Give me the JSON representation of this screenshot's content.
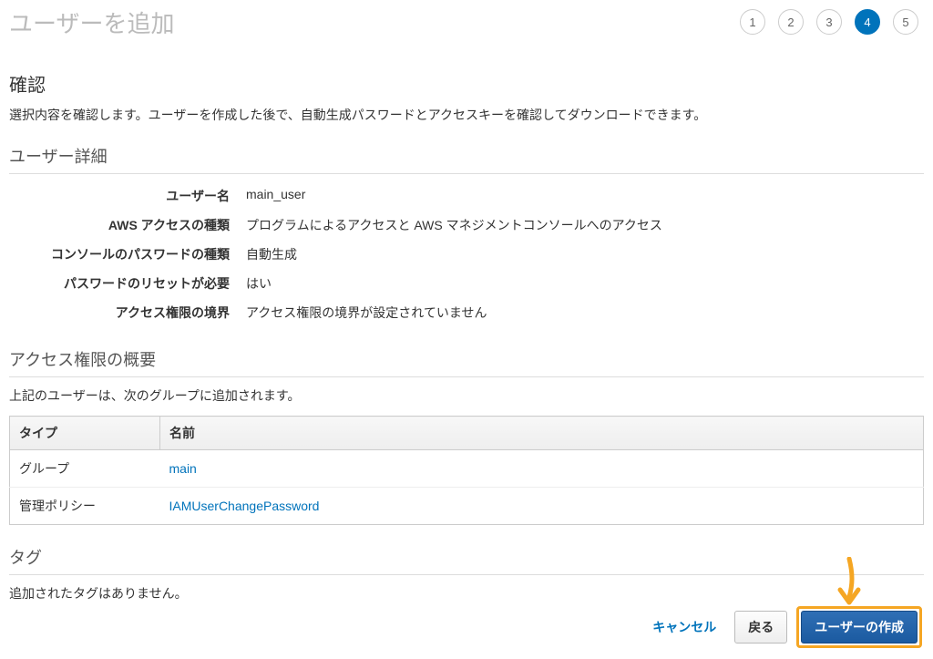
{
  "header": {
    "title": "ユーザーを追加",
    "steps": [
      "1",
      "2",
      "3",
      "4",
      "5"
    ],
    "active_step_index": 3
  },
  "confirm": {
    "heading": "確認",
    "description": "選択内容を確認します。ユーザーを作成した後で、自動生成パスワードとアクセスキーを確認してダウンロードできます。"
  },
  "user_details": {
    "heading": "ユーザー詳細",
    "rows": [
      {
        "label": "ユーザー名",
        "value": "main_user"
      },
      {
        "label": "AWS アクセスの種類",
        "value": "プログラムによるアクセスと AWS マネジメントコンソールへのアクセス"
      },
      {
        "label": "コンソールのパスワードの種類",
        "value": "自動生成"
      },
      {
        "label": "パスワードのリセットが必要",
        "value": "はい"
      },
      {
        "label": "アクセス権限の境界",
        "value": "アクセス権限の境界が設定されていません"
      }
    ]
  },
  "permissions": {
    "heading": "アクセス権限の概要",
    "description": "上記のユーザーは、次のグループに追加されます。",
    "columns": {
      "type": "タイプ",
      "name": "名前"
    },
    "rows": [
      {
        "type": "グループ",
        "name": "main"
      },
      {
        "type": "管理ポリシー",
        "name": "IAMUserChangePassword"
      }
    ]
  },
  "tags": {
    "heading": "タグ",
    "description": "追加されたタグはありません。"
  },
  "footer": {
    "cancel": "キャンセル",
    "back": "戻る",
    "create": "ユーザーの作成"
  }
}
